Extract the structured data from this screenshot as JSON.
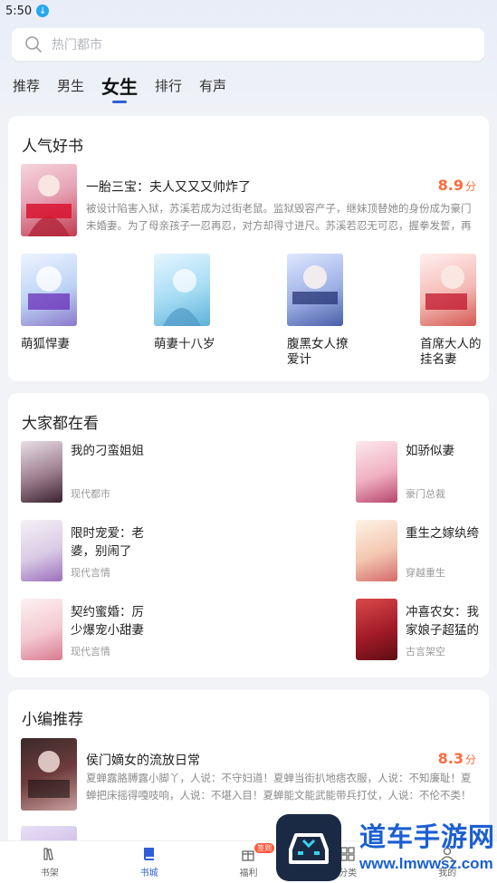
{
  "status": {
    "time": "5:50"
  },
  "search": {
    "placeholder": "热门都市"
  },
  "tabs": [
    {
      "label": "推荐"
    },
    {
      "label": "男生"
    },
    {
      "label": "女生",
      "active": true
    },
    {
      "label": "排行"
    },
    {
      "label": "有声"
    }
  ],
  "popular": {
    "title": "人气好书",
    "featured": {
      "title": "一胎三宝：夫人又又又帅炸了",
      "score": "8.9",
      "score_unit": "分",
      "desc": "被设计陷害入狱，苏溪若成为过街老鼠。监狱毁容产子，继妹顶替她的身份成为豪门未婚妻。为了母亲孩子一忍再忍，对方却得寸进尺。苏溪若忍无可忍，握拳发誓，再忍她就…"
    },
    "grid": [
      {
        "title": "萌狐悍妻"
      },
      {
        "title": "萌妻十八岁"
      },
      {
        "title": "腹黑女人撩爱计"
      },
      {
        "title": "首席大人的挂名妻"
      }
    ]
  },
  "watching": {
    "title": "大家都在看",
    "items": [
      {
        "title": "我的刁蛮姐姐",
        "category": "现代都市"
      },
      {
        "title": "如骄似妻",
        "category": "豪门总裁"
      },
      {
        "title": "限时宠爱：老婆，别闹了",
        "category": "现代言情"
      },
      {
        "title": "重生之嫁纨绔",
        "category": "穿越重生"
      },
      {
        "title": "契约蜜婚：厉少爆宠小甜妻",
        "category": "现代言情"
      },
      {
        "title": "冲喜农女：我家娘子超猛的",
        "category": "古言架空"
      }
    ]
  },
  "editor": {
    "title": "小编推荐",
    "featured": {
      "title": "侯门嫡女的流放日常",
      "score": "8.3",
      "score_unit": "分",
      "desc": "夏蝉露胳膊露小脚丫，人说：不守妇道！夏蝉当街扒地痞衣服，人说：不知廉耻！夏蝉把床摇得嘎吱响，人说：不堪入目！夏蝉能文能武能带兵打仗，人说：不伦不类！某…"
    }
  },
  "nav": [
    {
      "label": "书架"
    },
    {
      "label": "书城",
      "active": true
    },
    {
      "label": "福利",
      "badge": "签到"
    },
    {
      "label": "分类"
    },
    {
      "label": "我的"
    }
  ],
  "watermark": {
    "name": "道车手游网",
    "url": "www.lmwwsz.com"
  },
  "colors": {
    "accent": "#2f5ed9",
    "score": "#ff6a3d"
  }
}
